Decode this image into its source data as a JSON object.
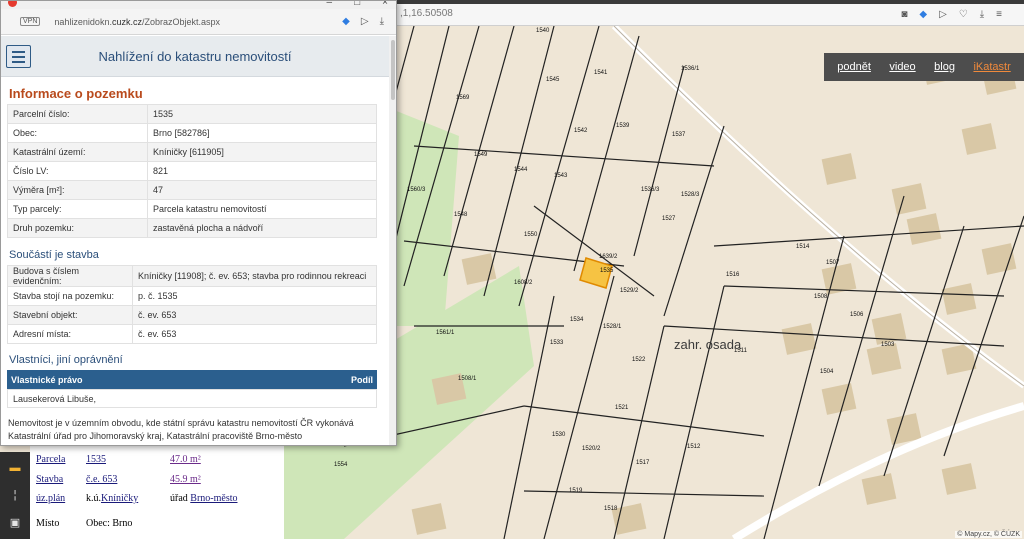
{
  "background_browser": {
    "url_fragment": ",1,16.50508"
  },
  "map": {
    "nav": [
      "podnět",
      "video",
      "blog",
      "iKatastr"
    ],
    "area_label": "zahr. osada",
    "credit": "© Mapy.cz, © ČÚZK",
    "selected_parcel": "1535",
    "parcel_labels": [
      "1540",
      "1536/1",
      "1545",
      "1569",
      "1541",
      "1542",
      "1539",
      "1537",
      "1549",
      "1544",
      "1543",
      "1536/3",
      "1528/3",
      "1560/3",
      "1548",
      "1527",
      "1550",
      "1639/2",
      "1608/2",
      "1535",
      "1516",
      "1514",
      "1507",
      "1529/2",
      "1508",
      "1506",
      "1534",
      "1528/1",
      "1561/1",
      "1533",
      "1511",
      "1503",
      "1504",
      "1522",
      "1508/1",
      "1521",
      "1530",
      "1517",
      "1512",
      "1520/2",
      "1554",
      "1519",
      "1518"
    ],
    "colors": {
      "background": "#efe6d6",
      "green": "#cfe6b8",
      "building": "#d9c8a6",
      "highlight": "#f6c343",
      "lines": "#222222"
    }
  },
  "popup": {
    "vpn": "VPN",
    "url_host": "nahlizenidokn.",
    "url_domain": "cuzk.cz",
    "url_path": "/ZobrazObjekt.aspx",
    "app_title": "Nahlížení do katastru nemovitostí",
    "pozemek": {
      "heading": "Informace o pozemku",
      "rows": [
        {
          "k": "Parcelní číslo:",
          "v": "1535"
        },
        {
          "k": "Obec:",
          "v": "Brno [582786]"
        },
        {
          "k": "Katastrální území:",
          "v": "Kníničky [611905]"
        },
        {
          "k": "Číslo LV:",
          "v": "821"
        },
        {
          "k": "Výměra [m²]:",
          "v": "47"
        },
        {
          "k": "Typ parcely:",
          "v": "Parcela katastru nemovitostí"
        },
        {
          "k": "Druh pozemku:",
          "v": "zastavěná plocha a nádvoří"
        }
      ]
    },
    "stavba": {
      "heading": "Součástí je stavba",
      "rows": [
        {
          "k": "Budova s číslem evidenčním:",
          "v": "Kníničky [11908]; č. ev. 653; stavba pro rodinnou rekreaci"
        },
        {
          "k": "Stavba stojí na pozemku:",
          "v": "p. č. 1535"
        },
        {
          "k": "Stavební objekt:",
          "v": "č. ev. 653"
        },
        {
          "k": "Adresní místa:",
          "v": "č. ev. 653"
        }
      ]
    },
    "vlastnici": {
      "heading": "Vlastníci, jiní oprávnění",
      "col1": "Vlastnické právo",
      "col2": "Podíl",
      "owner": "Lausekerová Libuše,"
    },
    "note": "Nemovitost je v územním obvodu, kde státní správu katastru nemovitostí ČR vykonává Katastrální úřad pro Jihomoravský kraj, Katastrální pracoviště Brno-město"
  },
  "info_lower": {
    "parcela_label": "Parcela",
    "parcela_value": "1535",
    "parcela_area": "47.0 m²",
    "stavba_label": "Stavba",
    "stavba_value": "č.e. 653",
    "stavba_area": "45.9 m²",
    "uzplan_label": "úz.plán",
    "ku_prefix": "k.ú.",
    "ku_value": "Kníničky",
    "urad_prefix": "úřad",
    "urad_value": "Brno-město",
    "misto_label": "Místo",
    "misto_value": "Obec: Brno"
  }
}
